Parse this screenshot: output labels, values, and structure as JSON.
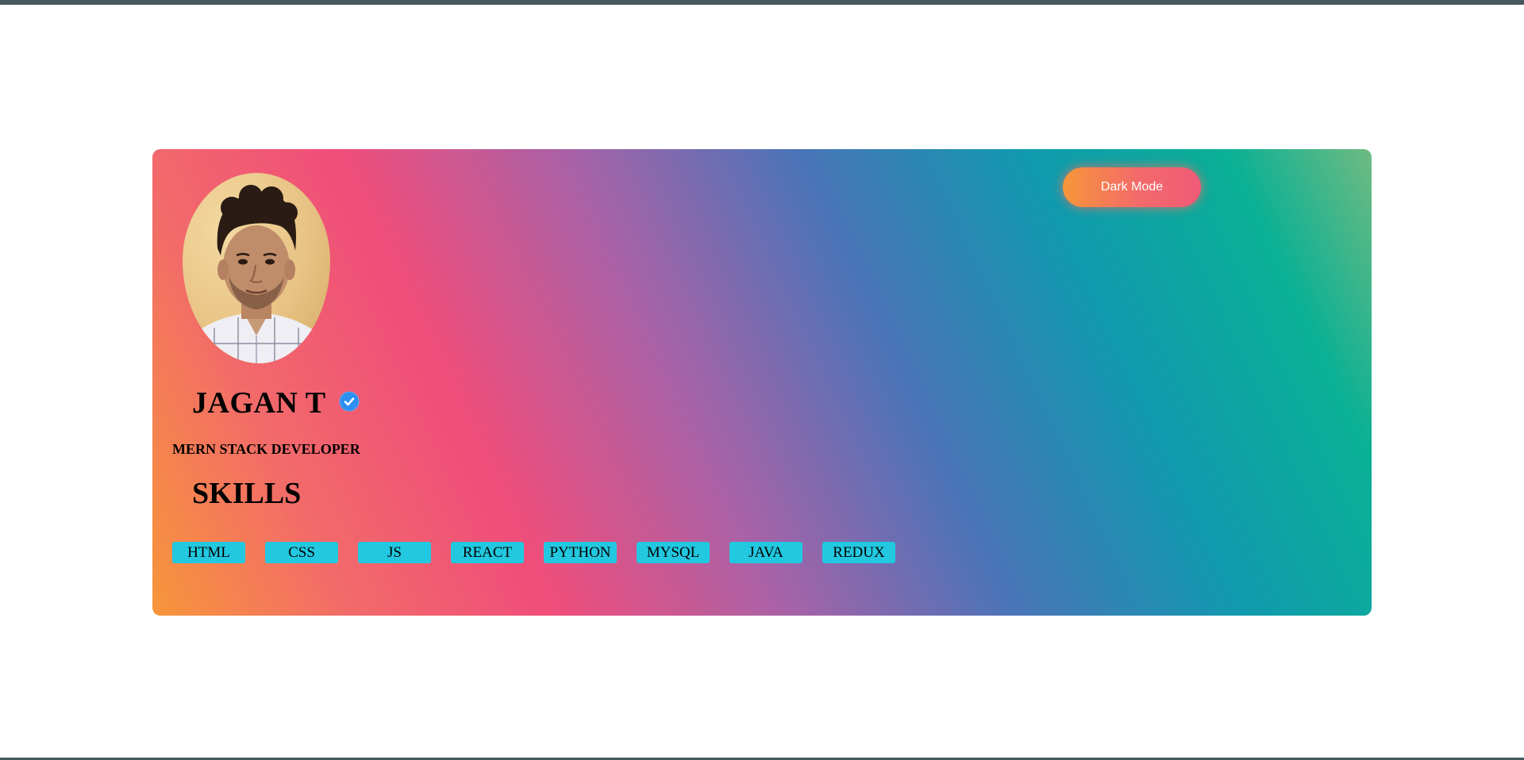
{
  "profile": {
    "name": "JAGAN T",
    "role": "MERN STACK DEVELOPER",
    "verified_icon": "verified-badge-icon",
    "avatar_icon": "profile-photo"
  },
  "skills": {
    "heading": "SKILLS",
    "items": [
      "HTML",
      "CSS",
      "JS",
      "REACT",
      "PYTHON",
      "MYSQL",
      "JAVA",
      "REDUX"
    ]
  },
  "controls": {
    "dark_mode_label": "Dark Mode"
  },
  "colors": {
    "skill_chip": "#22c8e0",
    "verified_badge": "#2d8ff0",
    "page_background": "#ffffff",
    "top_bar": "#45585e"
  }
}
